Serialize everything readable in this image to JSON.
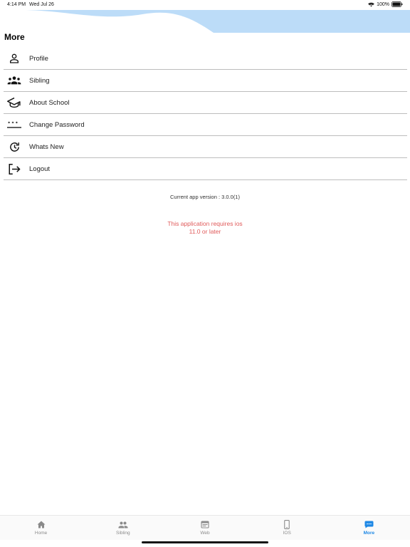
{
  "status_bar": {
    "time": "4:14 PM",
    "date": "Wed Jul 26",
    "battery": "100%",
    "icons": [
      "wifi-icon",
      "battery-icon"
    ]
  },
  "header": {
    "title": "More",
    "wave_color": "#bcdcf8"
  },
  "menu": {
    "items": [
      {
        "label": "Profile",
        "icon": "person-icon"
      },
      {
        "label": "Sibling",
        "icon": "group-icon"
      },
      {
        "label": "About School",
        "icon": "graduation-cap-icon"
      },
      {
        "label": "Change Password",
        "icon": "password-icon"
      },
      {
        "label": "Whats New",
        "icon": "update-icon"
      },
      {
        "label": "Logout",
        "icon": "logout-icon"
      }
    ]
  },
  "version_text": "Current app version : 3.0.0(1)",
  "requirement": {
    "line1": "This application requires ios",
    "line2": "11.0 or later",
    "color": "#e05a5a"
  },
  "tab_bar": {
    "active_color": "#1e88e5",
    "inactive_color": "#8a8a8a",
    "tabs": [
      {
        "label": "Home",
        "icon": "home-icon",
        "active": false
      },
      {
        "label": "Sibling",
        "icon": "people-icon",
        "active": false
      },
      {
        "label": "Web",
        "icon": "web-icon",
        "active": false
      },
      {
        "label": "IOS",
        "icon": "phone-icon",
        "active": false
      },
      {
        "label": "More",
        "icon": "more-chat-icon",
        "active": true
      }
    ]
  }
}
